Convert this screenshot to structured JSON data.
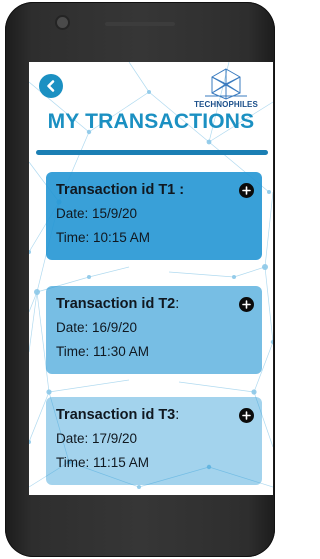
{
  "header": {
    "back_icon": "back-arrow-icon",
    "logo_icon": "geodesic-dome-icon",
    "logo_text": "TECHNOPHILES",
    "title": "MY TRANSACTIONS"
  },
  "transactions": [
    {
      "id_label": "Transaction id T1 :",
      "id_label_main": "Transaction id T1 :",
      "id_label_suffix": "",
      "date": "Date: 15/9/20",
      "time": "Time: 10:15 AM",
      "expand_icon": "plus-circle-icon"
    },
    {
      "id_label": "Transaction id T2:",
      "id_label_main": "Transaction id T2",
      "id_label_suffix": ":",
      "date": "Date: 16/9/20",
      "time": "Time: 11:30 AM",
      "expand_icon": "plus-circle-icon"
    },
    {
      "id_label": "Transaction id T3:",
      "id_label_main": "Transaction id T3",
      "id_label_suffix": ":",
      "date": "Date: 17/9/20",
      "time": "Time: 11:15 AM",
      "expand_icon": "plus-circle-icon"
    }
  ],
  "colors": {
    "accent": "#1b90c2",
    "title_rule": "#1b7fb4",
    "card": "#2496d4",
    "logo_text": "#1b4f8a",
    "device_frame": "#2e2e2e"
  }
}
